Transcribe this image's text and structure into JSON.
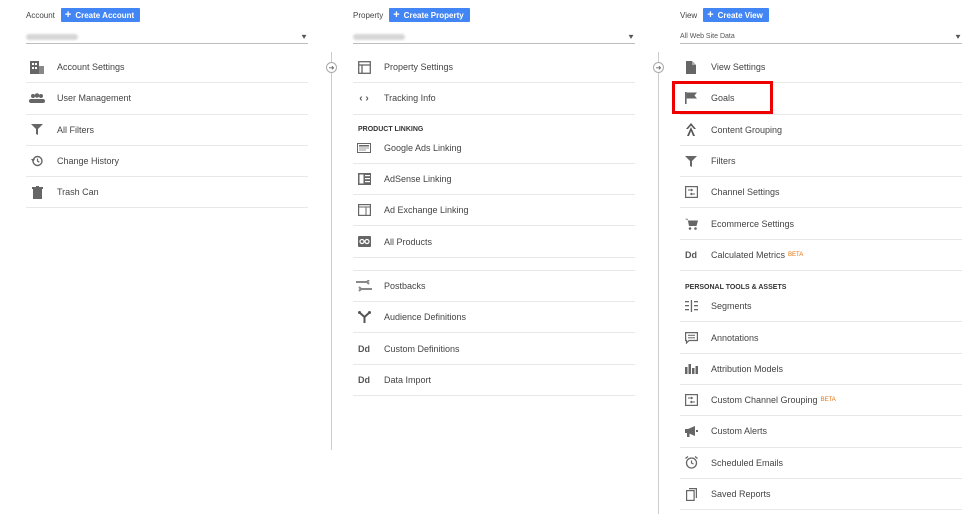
{
  "account": {
    "title": "Account",
    "create_label": "Create Account",
    "items": [
      {
        "label": "Account Settings",
        "icon": "building-icon"
      },
      {
        "label": "User Management",
        "icon": "people-icon"
      },
      {
        "label": "All Filters",
        "icon": "filter-icon"
      },
      {
        "label": "Change History",
        "icon": "history-icon"
      },
      {
        "label": "Trash Can",
        "icon": "trash-icon"
      }
    ]
  },
  "property": {
    "title": "Property",
    "create_label": "Create Property",
    "items": [
      {
        "label": "Property Settings",
        "icon": "window-icon"
      },
      {
        "label": "Tracking Info",
        "icon": "code-icon"
      }
    ],
    "product_linking_label": "PRODUCT LINKING",
    "linking_items": [
      {
        "label": "Google Ads Linking",
        "icon": "ads-icon"
      },
      {
        "label": "AdSense Linking",
        "icon": "adsense-icon"
      },
      {
        "label": "Ad Exchange Linking",
        "icon": "adexchange-icon"
      },
      {
        "label": "All Products",
        "icon": "products-icon"
      }
    ],
    "other_items": [
      {
        "label": "Postbacks",
        "icon": "postbacks-icon"
      },
      {
        "label": "Audience Definitions",
        "icon": "fork-icon"
      },
      {
        "label": "Custom Definitions",
        "icon": "dd-icon"
      },
      {
        "label": "Data Import",
        "icon": "dd-icon"
      }
    ]
  },
  "view": {
    "title": "View",
    "create_label": "Create View",
    "selected": "All Web Site Data",
    "items": [
      {
        "label": "View Settings",
        "icon": "document-icon"
      },
      {
        "label": "Goals",
        "icon": "flag-icon"
      },
      {
        "label": "Content Grouping",
        "icon": "person-walk-icon"
      },
      {
        "label": "Filters",
        "icon": "filter-icon"
      },
      {
        "label": "Channel Settings",
        "icon": "channel-icon"
      },
      {
        "label": "Ecommerce Settings",
        "icon": "cart-icon"
      },
      {
        "label": "Calculated Metrics",
        "icon": "dd-icon",
        "badge": "BETA"
      }
    ],
    "personal_label": "PERSONAL TOOLS & ASSETS",
    "personal_items": [
      {
        "label": "Segments",
        "icon": "segments-icon"
      },
      {
        "label": "Annotations",
        "icon": "comment-icon"
      },
      {
        "label": "Attribution Models",
        "icon": "bar-chart-icon"
      },
      {
        "label": "Custom Channel Grouping",
        "icon": "channel-icon",
        "badge": "BETA"
      },
      {
        "label": "Custom Alerts",
        "icon": "megaphone-icon"
      },
      {
        "label": "Scheduled Emails",
        "icon": "alarm-icon"
      },
      {
        "label": "Saved Reports",
        "icon": "copy-icon"
      }
    ]
  },
  "colors": {
    "accent": "#4285f4",
    "highlight": "#ee0000",
    "beta": "#e8710a"
  }
}
